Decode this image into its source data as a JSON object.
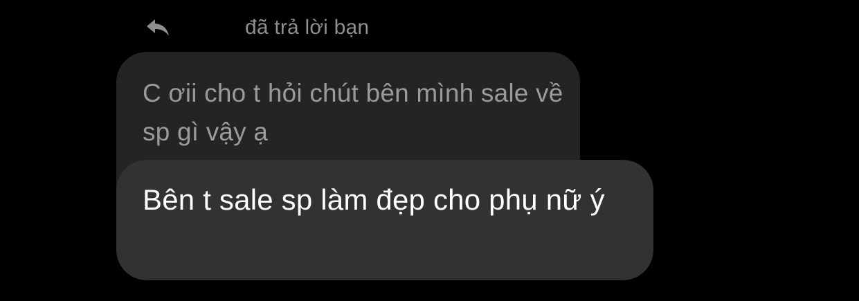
{
  "reply_header": {
    "icon": "reply-arrow-icon",
    "sender_name": "",
    "text": "đã trả lời bạn"
  },
  "quoted_message": {
    "text": "C ơii cho t hỏi chút bên mình sale về sp gì vậy ạ"
  },
  "reply_message": {
    "text": "Bên t sale sp làm đẹp cho phụ nữ ý"
  },
  "colors": {
    "background": "#000000",
    "quoted_bubble": "#242424",
    "reply_bubble": "#323232",
    "secondary_text": "#8e8e93",
    "primary_text": "#ffffff"
  }
}
